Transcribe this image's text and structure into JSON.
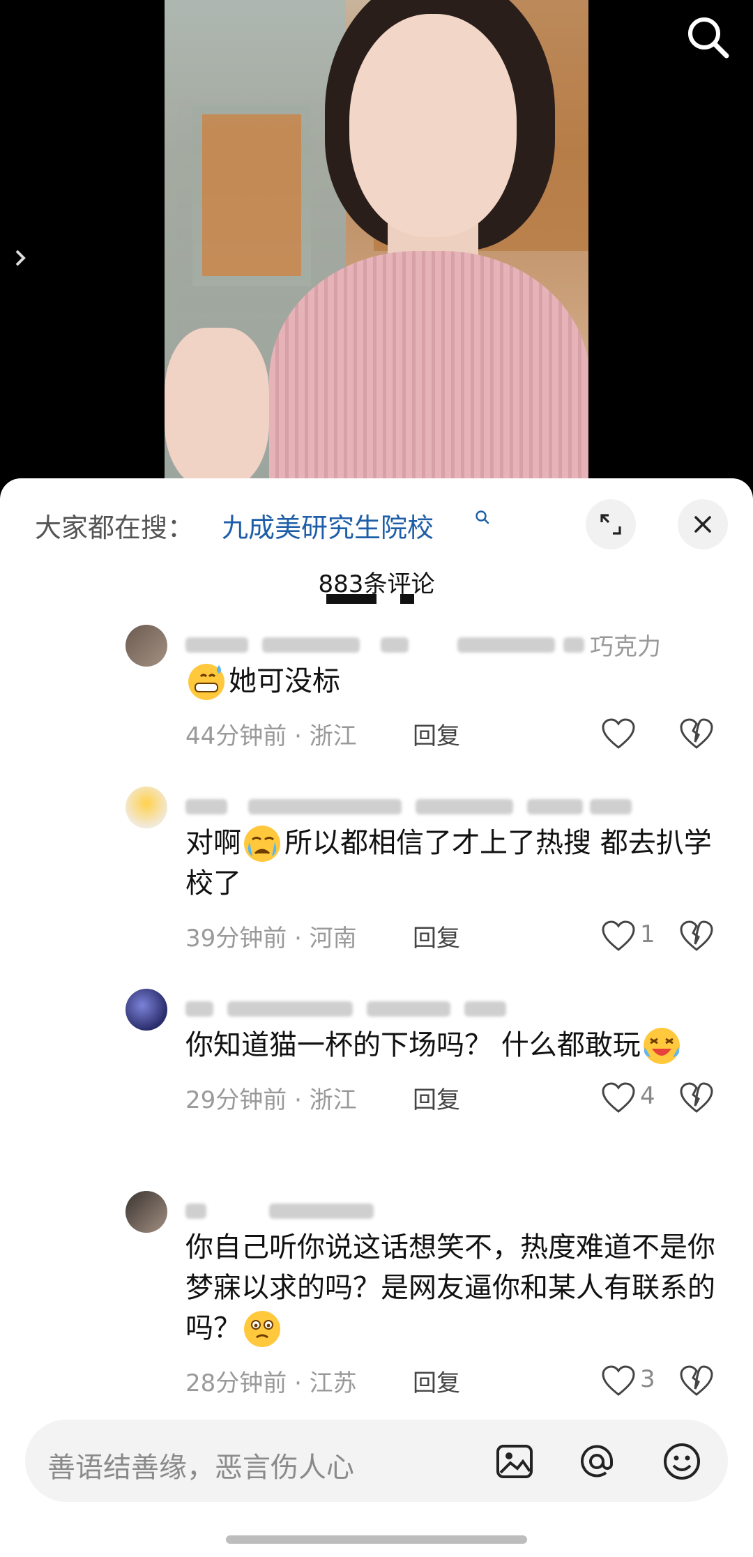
{
  "video": {
    "search_icon": "search-icon",
    "side_arrow_icon": "chevron-right-icon"
  },
  "sheet": {
    "trending_prefix": "大家都在搜：",
    "trending_query": "九成美研究生院校",
    "comment_count": "883条评论"
  },
  "comments": [
    {
      "user_suffix": "巧克力",
      "text": "她可没标",
      "leading_emoji": "grimace-sweat-emoji",
      "time_location": "44分钟前 · 浙江",
      "reply_label": "回复",
      "likes": ""
    },
    {
      "user_suffix": "",
      "text_parts": [
        "对啊",
        "所以都相信了才上了热搜 都去扒学校了"
      ],
      "inline_emoji": "crying-emoji",
      "time_location": "39分钟前 · 河南",
      "reply_label": "回复",
      "likes": "1"
    },
    {
      "user_suffix": "",
      "text": "你知道猫一杯的下场吗？ 什么都敢玩",
      "trailing_emoji": "laughing-crying-emoji",
      "time_location": "29分钟前 · 浙江",
      "reply_label": "回复",
      "likes": "4"
    },
    {
      "user_suffix": "",
      "text": "你自己听你说这话想笑不，热度难道不是你梦寐以求的吗？是网友逼你和某人有联系的吗？",
      "trailing_emoji": "flustered-emoji",
      "time_location": "28分钟前 · 江苏",
      "reply_label": "回复",
      "likes": "3"
    }
  ],
  "input": {
    "placeholder": "善语结善缘，恶言伤人心",
    "icons": [
      "image-icon",
      "at-icon",
      "emoji-icon"
    ]
  },
  "colors": {
    "link": "#1e5ea8",
    "muted": "#999999",
    "sheet_bg": "#ffffff"
  }
}
